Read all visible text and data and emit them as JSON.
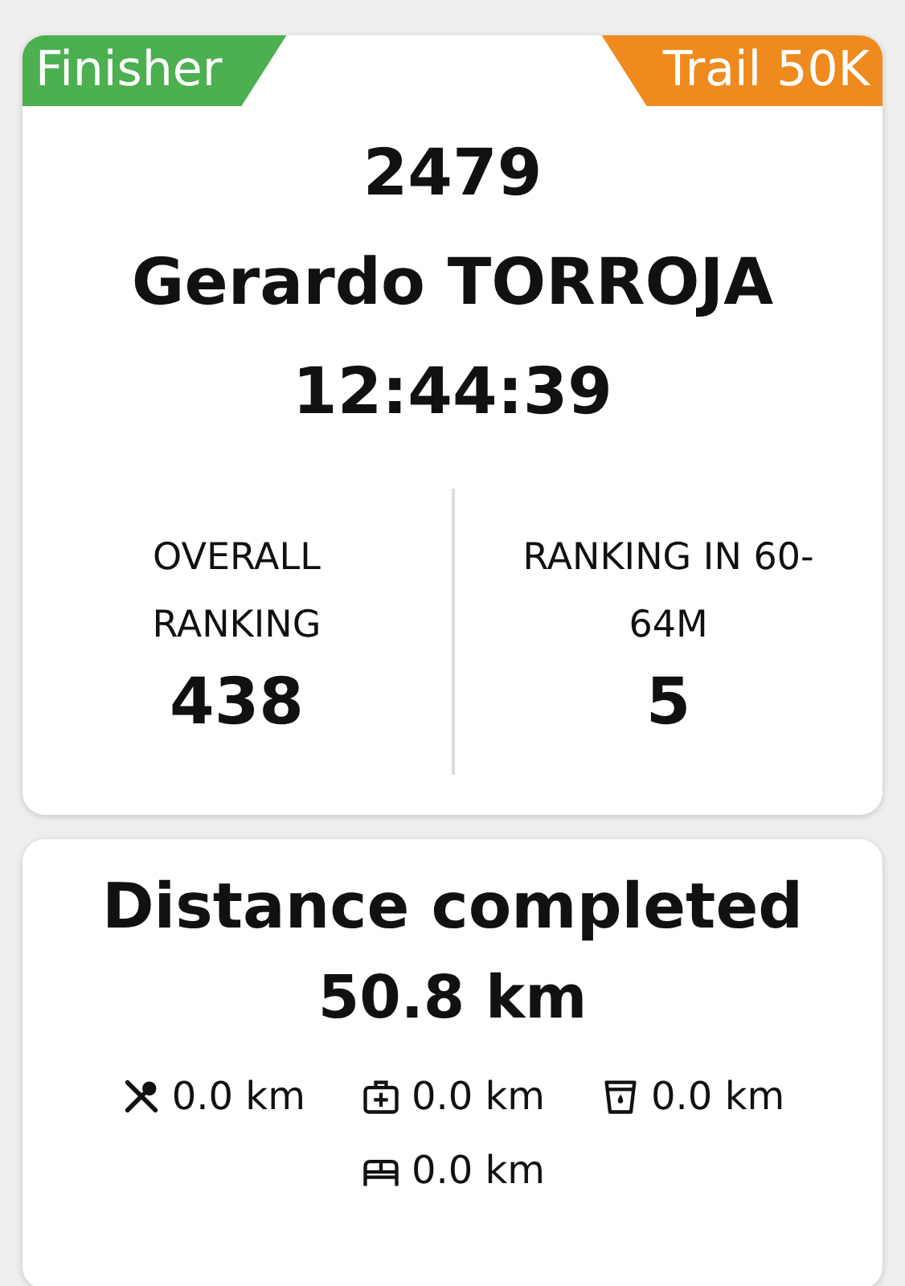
{
  "result_card": {
    "status_ribbon": {
      "label": "Finisher",
      "color": "#4caf50"
    },
    "race_ribbon": {
      "label": "Trail 50K",
      "color": "#ef8a1e"
    },
    "bib": "2479",
    "name": "Gerardo TORROJA",
    "time": "12:44:39",
    "rankings": [
      {
        "label": "OVERALL RANKING",
        "value": "438"
      },
      {
        "label": "RANKING IN 60-64M",
        "value": "5"
      }
    ]
  },
  "distance_card": {
    "title": "Distance completed",
    "distance": "50.8 km",
    "stops": [
      {
        "kind": "food",
        "value": "0.0 km"
      },
      {
        "kind": "aid",
        "value": "0.0 km"
      },
      {
        "kind": "water",
        "value": "0.0 km"
      },
      {
        "kind": "bed",
        "value": "0.0 km"
      }
    ]
  }
}
